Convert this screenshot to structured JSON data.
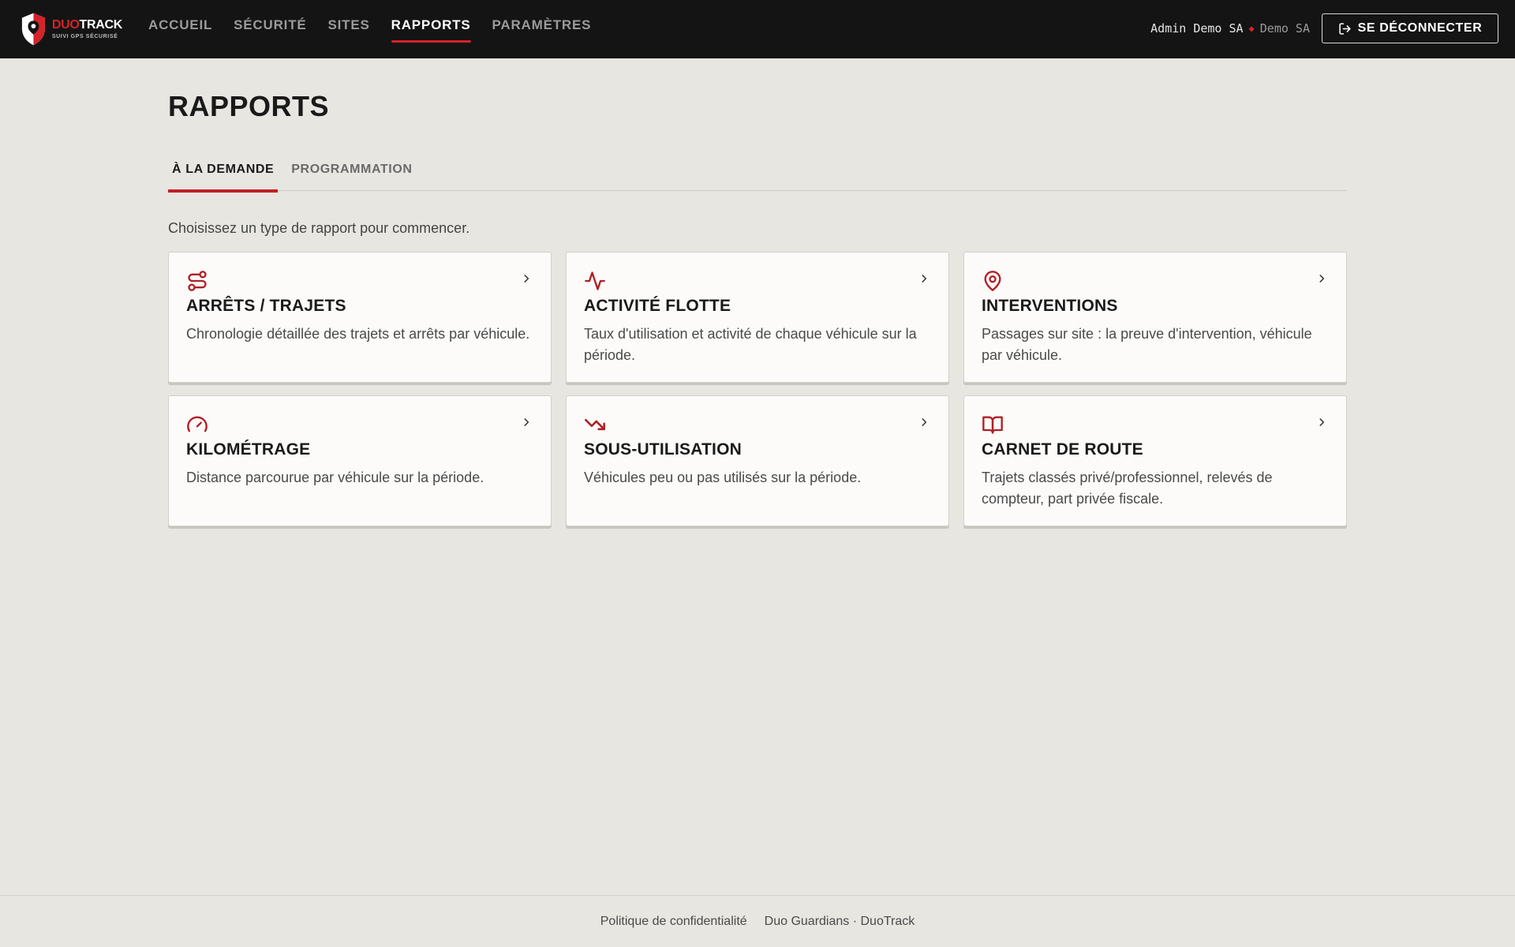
{
  "brand": {
    "name_part1": "DUO",
    "name_part2": "TRACK",
    "tagline": "SUIVI GPS SÉCURISÉ",
    "accent_color": "#d4232a"
  },
  "nav": {
    "items": [
      {
        "label": "ACCUEIL",
        "active": false
      },
      {
        "label": "SÉCURITÉ",
        "active": false
      },
      {
        "label": "SITES",
        "active": false
      },
      {
        "label": "RAPPORTS",
        "active": true
      },
      {
        "label": "PARAMÈTRES",
        "active": false
      }
    ]
  },
  "user": {
    "name": "Admin Demo SA",
    "separator": "◆",
    "org": "Demo SA"
  },
  "logout": {
    "label": "SE DÉCONNECTER",
    "icon": "logout-icon"
  },
  "page": {
    "title": "RAPPORTS",
    "intro": "Choisissez un type de rapport pour commencer."
  },
  "tabs": [
    {
      "label": "À LA DEMANDE",
      "active": true
    },
    {
      "label": "PROGRAMMATION",
      "active": false
    }
  ],
  "reports": [
    {
      "icon": "route-icon",
      "title": "ARRÊTS / TRAJETS",
      "description": "Chronologie détaillée des trajets et arrêts par véhicule."
    },
    {
      "icon": "activity-icon",
      "title": "ACTIVITÉ FLOTTE",
      "description": "Taux d'utilisation et activité de chaque véhicule sur la période."
    },
    {
      "icon": "map-pin-icon",
      "title": "INTERVENTIONS",
      "description": "Passages sur site : la preuve d'intervention, véhicule par véhicule."
    },
    {
      "icon": "gauge-icon",
      "title": "KILOMÉTRAGE",
      "description": "Distance parcourue par véhicule sur la période."
    },
    {
      "icon": "trending-down-icon",
      "title": "SOUS-UTILISATION",
      "description": "Véhicules peu ou pas utilisés sur la période."
    },
    {
      "icon": "book-open-icon",
      "title": "CARNET DE ROUTE",
      "description": "Trajets classés privé/professionnel, relevés de compteur, part privée fiscale."
    }
  ],
  "footer": {
    "privacy_link": "Politique de confidentialité",
    "credits": "Duo Guardians · DuoTrack"
  }
}
